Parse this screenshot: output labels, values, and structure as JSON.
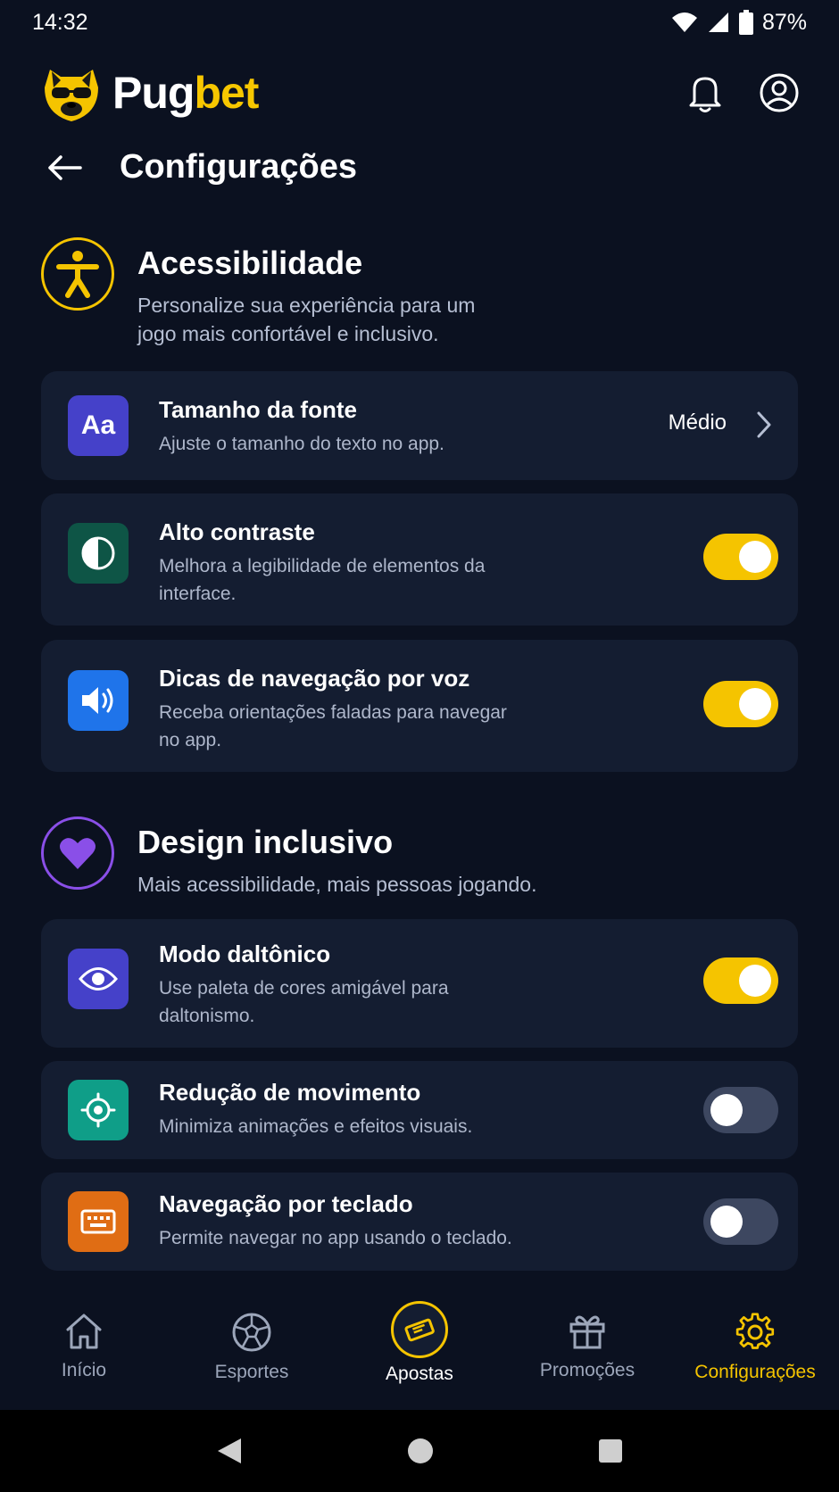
{
  "status_bar": {
    "time": "14:32",
    "battery": "87%"
  },
  "brand": {
    "part1": "Pug",
    "part2": "bet"
  },
  "page": {
    "title": "Configurações"
  },
  "accessibility": {
    "title": "Acessibilidade",
    "subtitle": "Personalize sua experiência para um jogo mais confortável e inclusivo.",
    "items": [
      {
        "title": "Tamanho da fonte",
        "desc": "Ajuste o tamanho do texto no app.",
        "value": "Médio",
        "icon": "font-size-icon",
        "icon_text": "Aa"
      },
      {
        "title": "Alto contraste",
        "desc": "Melhora a legibilidade de elementos da interface.",
        "enabled": true,
        "icon": "contrast-icon"
      },
      {
        "title": "Dicas de navegação por voz",
        "desc": "Receba orientações faladas para navegar no app.",
        "enabled": true,
        "icon": "speaker-icon"
      }
    ]
  },
  "inclusive": {
    "title": "Design inclusivo",
    "subtitle": "Mais acessibilidade, mais pessoas jogando.",
    "items": [
      {
        "title": "Modo daltônico",
        "desc": "Use paleta de cores amigável para daltonismo.",
        "enabled": true,
        "icon": "eye-icon"
      },
      {
        "title": "Redução de movimento",
        "desc": "Minimiza animações e efeitos visuais.",
        "enabled": false,
        "icon": "motion-target-icon"
      },
      {
        "title": "Navegação por teclado",
        "desc": "Permite navegar no app usando o teclado.",
        "enabled": false,
        "icon": "keyboard-icon"
      }
    ]
  },
  "nav": {
    "items": [
      {
        "label": "Início",
        "icon": "home-icon"
      },
      {
        "label": "Esportes",
        "icon": "soccer-ball-icon"
      },
      {
        "label": "Apostas",
        "icon": "ticket-icon"
      },
      {
        "label": "Promoções",
        "icon": "gift-icon"
      },
      {
        "label": "Configurações",
        "icon": "gear-icon"
      }
    ]
  },
  "colors": {
    "background": "#0b1120",
    "card": "#141d31",
    "accent": "#f5c400",
    "toggle_off": "#3d4760",
    "purple": "#8a4fe8"
  }
}
